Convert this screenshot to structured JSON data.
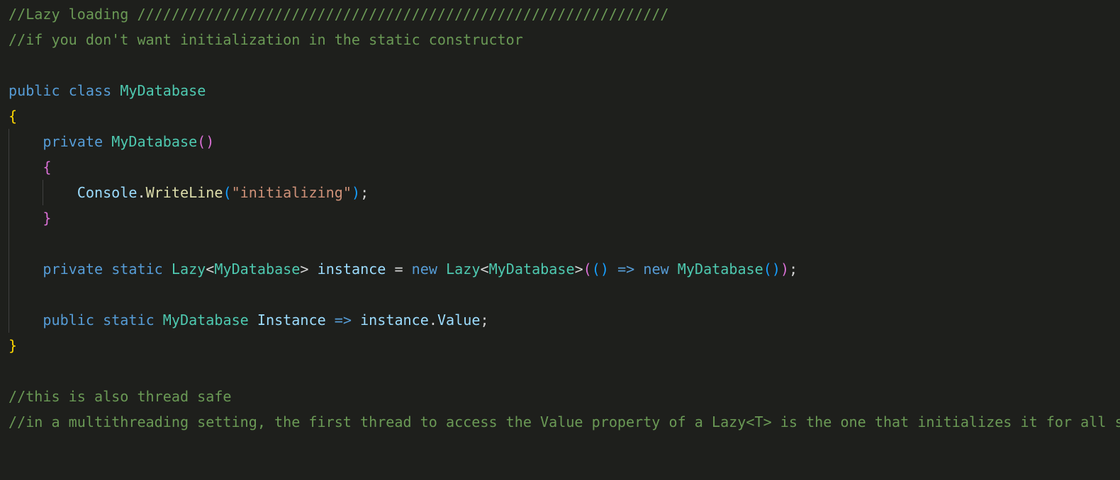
{
  "code": {
    "l1_a": "//Lazy loading ",
    "l1_b": "//////////////////////////////////////////////////////////////",
    "l2": "//if you don't want initialization in the static constructor",
    "l4_public": "public",
    "l4_class": "class",
    "l4_type": "MyDatabase",
    "l5_brace": "{",
    "l6_private": "private",
    "l6_ctor": "MyDatabase",
    "l6_paren": "()",
    "l7_brace": "{",
    "l8_console": "Console",
    "l8_dot": ".",
    "l8_writeline": "WriteLine",
    "l8_lp": "(",
    "l8_str": "\"initializing\"",
    "l8_rp": ")",
    "l8_semi": ";",
    "l9_brace": "}",
    "l11_private": "private",
    "l11_static": "static",
    "l11_lazy": "Lazy",
    "l11_lt": "<",
    "l11_mydb": "MyDatabase",
    "l11_gt": ">",
    "l11_instance": "instance",
    "l11_eq": " = ",
    "l11_new": "new",
    "l11_lazy2": "Lazy",
    "l11_lt2": "<",
    "l11_mydb2": "MyDatabase",
    "l11_gt2": ">",
    "l11_lp1": "(",
    "l11_lp2": "()",
    "l11_arrow": " => ",
    "l11_new2": "new",
    "l11_mydb3": "MyDatabase",
    "l11_lp3": "()",
    "l11_rp1": ")",
    "l11_semi": ";",
    "l13_public": "public",
    "l13_static": "static",
    "l13_mydb": "MyDatabase",
    "l13_Instance": "Instance",
    "l13_arrow": " => ",
    "l13_instance": "instance",
    "l13_dot": ".",
    "l13_Value": "Value",
    "l13_semi": ";",
    "l14_brace": "}",
    "l16": "//this is also thread safe",
    "l17": "//in a multithreading setting, the first thread to access the Value property of a Lazy<T> is the one that initializes it for all subsequent accesses on all threads"
  }
}
